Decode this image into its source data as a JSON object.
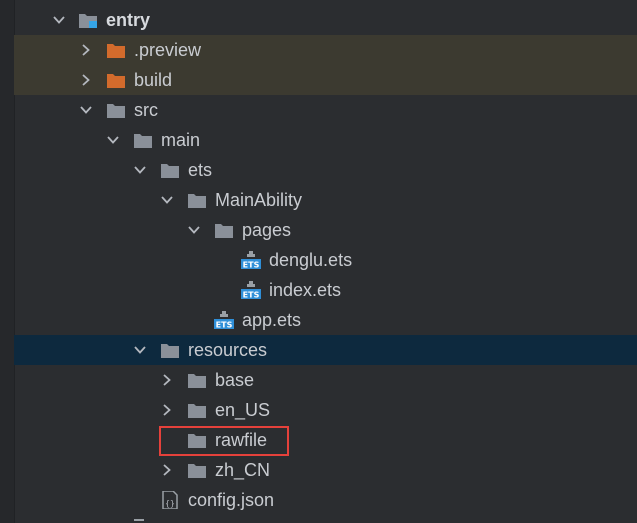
{
  "project_tree": {
    "rows": [
      {
        "label": "entry",
        "icon": "module-folder-icon"
      },
      {
        "label": ".preview",
        "icon": "excluded-folder-icon"
      },
      {
        "label": "build",
        "icon": "excluded-folder-icon"
      },
      {
        "label": "src",
        "icon": "folder-icon"
      },
      {
        "label": "main",
        "icon": "folder-icon"
      },
      {
        "label": "ets",
        "icon": "folder-icon"
      },
      {
        "label": "MainAbility",
        "icon": "folder-icon"
      },
      {
        "label": "pages",
        "icon": "folder-icon"
      },
      {
        "label": "denglu.ets",
        "icon": "ets-file-icon",
        "badge": "ETS"
      },
      {
        "label": "index.ets",
        "icon": "ets-file-icon",
        "badge": "ETS"
      },
      {
        "label": "app.ets",
        "icon": "ets-file-icon",
        "badge": "ETS"
      },
      {
        "label": "resources",
        "icon": "folder-icon"
      },
      {
        "label": "base",
        "icon": "folder-icon"
      },
      {
        "label": "en_US",
        "icon": "folder-icon"
      },
      {
        "label": "rawfile",
        "icon": "folder-icon"
      },
      {
        "label": "zh_CN",
        "icon": "folder-icon"
      },
      {
        "label": "config.json",
        "icon": "json-file-icon",
        "badge": "{}"
      }
    ]
  },
  "colors": {
    "background": "#2b2d30",
    "excluded_row": "#3c3a30",
    "selected_row": "#0d293e",
    "excluded_folder": "#d36b2c",
    "folder": "#8a9099",
    "ets_badge": "#2f8fd8",
    "highlight": "#e5413b"
  }
}
